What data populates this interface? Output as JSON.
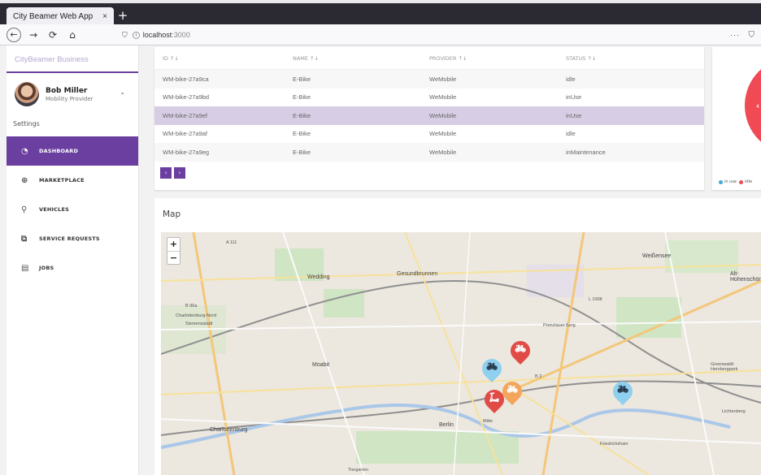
{
  "browser": {
    "tab_title": "City Beamer Web App",
    "tab_close": "×",
    "new_tab": "+",
    "url_host": "localhost",
    "url_port": ":3000",
    "menu": "···"
  },
  "sidebar": {
    "brand": "CityBeamer Business",
    "user_name": "Bob Miller",
    "user_role": "Mobility Provider",
    "settings_label": "Settings",
    "items": [
      {
        "label": "DASHBOARD",
        "icon": "dashboard-icon",
        "active": true
      },
      {
        "label": "MARKETPLACE",
        "icon": "globe-icon",
        "active": false
      },
      {
        "label": "VEHICLES",
        "icon": "bike-icon",
        "active": false
      },
      {
        "label": "SERVICE REQUESTS",
        "icon": "requests-icon",
        "active": false
      },
      {
        "label": "JOBS",
        "icon": "clipboard-icon",
        "active": false
      }
    ]
  },
  "table": {
    "columns": [
      "ID ↑↓",
      "NAME ↑↓",
      "PROVIDER ↑↓",
      "STATUS ↑↓"
    ],
    "rows": [
      {
        "id": "WM-bike-27a9ca",
        "name": "E-Bike",
        "provider": "WeMobile",
        "status": "idle"
      },
      {
        "id": "WM-bike-27a9bd",
        "name": "E-Bike",
        "provider": "WeMobile",
        "status": "inUse"
      },
      {
        "id": "WM-bike-27a9ef",
        "name": "E-Bike",
        "provider": "WeMobile",
        "status": "inUse"
      },
      {
        "id": "WM-bike-27a9af",
        "name": "E-Bike",
        "provider": "WeMobile",
        "status": "idle"
      },
      {
        "id": "WM-bike-27a9eg",
        "name": "E-Bike",
        "provider": "WeMobile",
        "status": "inMaintenance"
      }
    ],
    "selected_row": 2,
    "prev": "‹",
    "next": "›"
  },
  "pie": {
    "legend": [
      "in use",
      "idle"
    ],
    "colors": {
      "in_use": "#3fa9d8",
      "idle": "#f04a55"
    },
    "slice_label": "4"
  },
  "map": {
    "title": "Map",
    "zoom_in": "+",
    "zoom_out": "−",
    "labels": [
      "Wedding",
      "Gesundbrunnen",
      "Weißensee",
      "Alt-Hohenschönhausen",
      "Prenzlauer Berg",
      "Moabit",
      "Charlottenburg",
      "Berlin",
      "Mitte",
      "Friedrichshain",
      "Lichtenberg",
      "Tiergarten",
      "Charlottenburg-Nord",
      "Siemensstadt",
      "Greenwaldt Herzbergpark",
      "A 111",
      "B 96a",
      "L 1008",
      "B 2"
    ]
  },
  "colors": {
    "accent": "#6a3fa0",
    "selected_row": "#d7cde5"
  }
}
